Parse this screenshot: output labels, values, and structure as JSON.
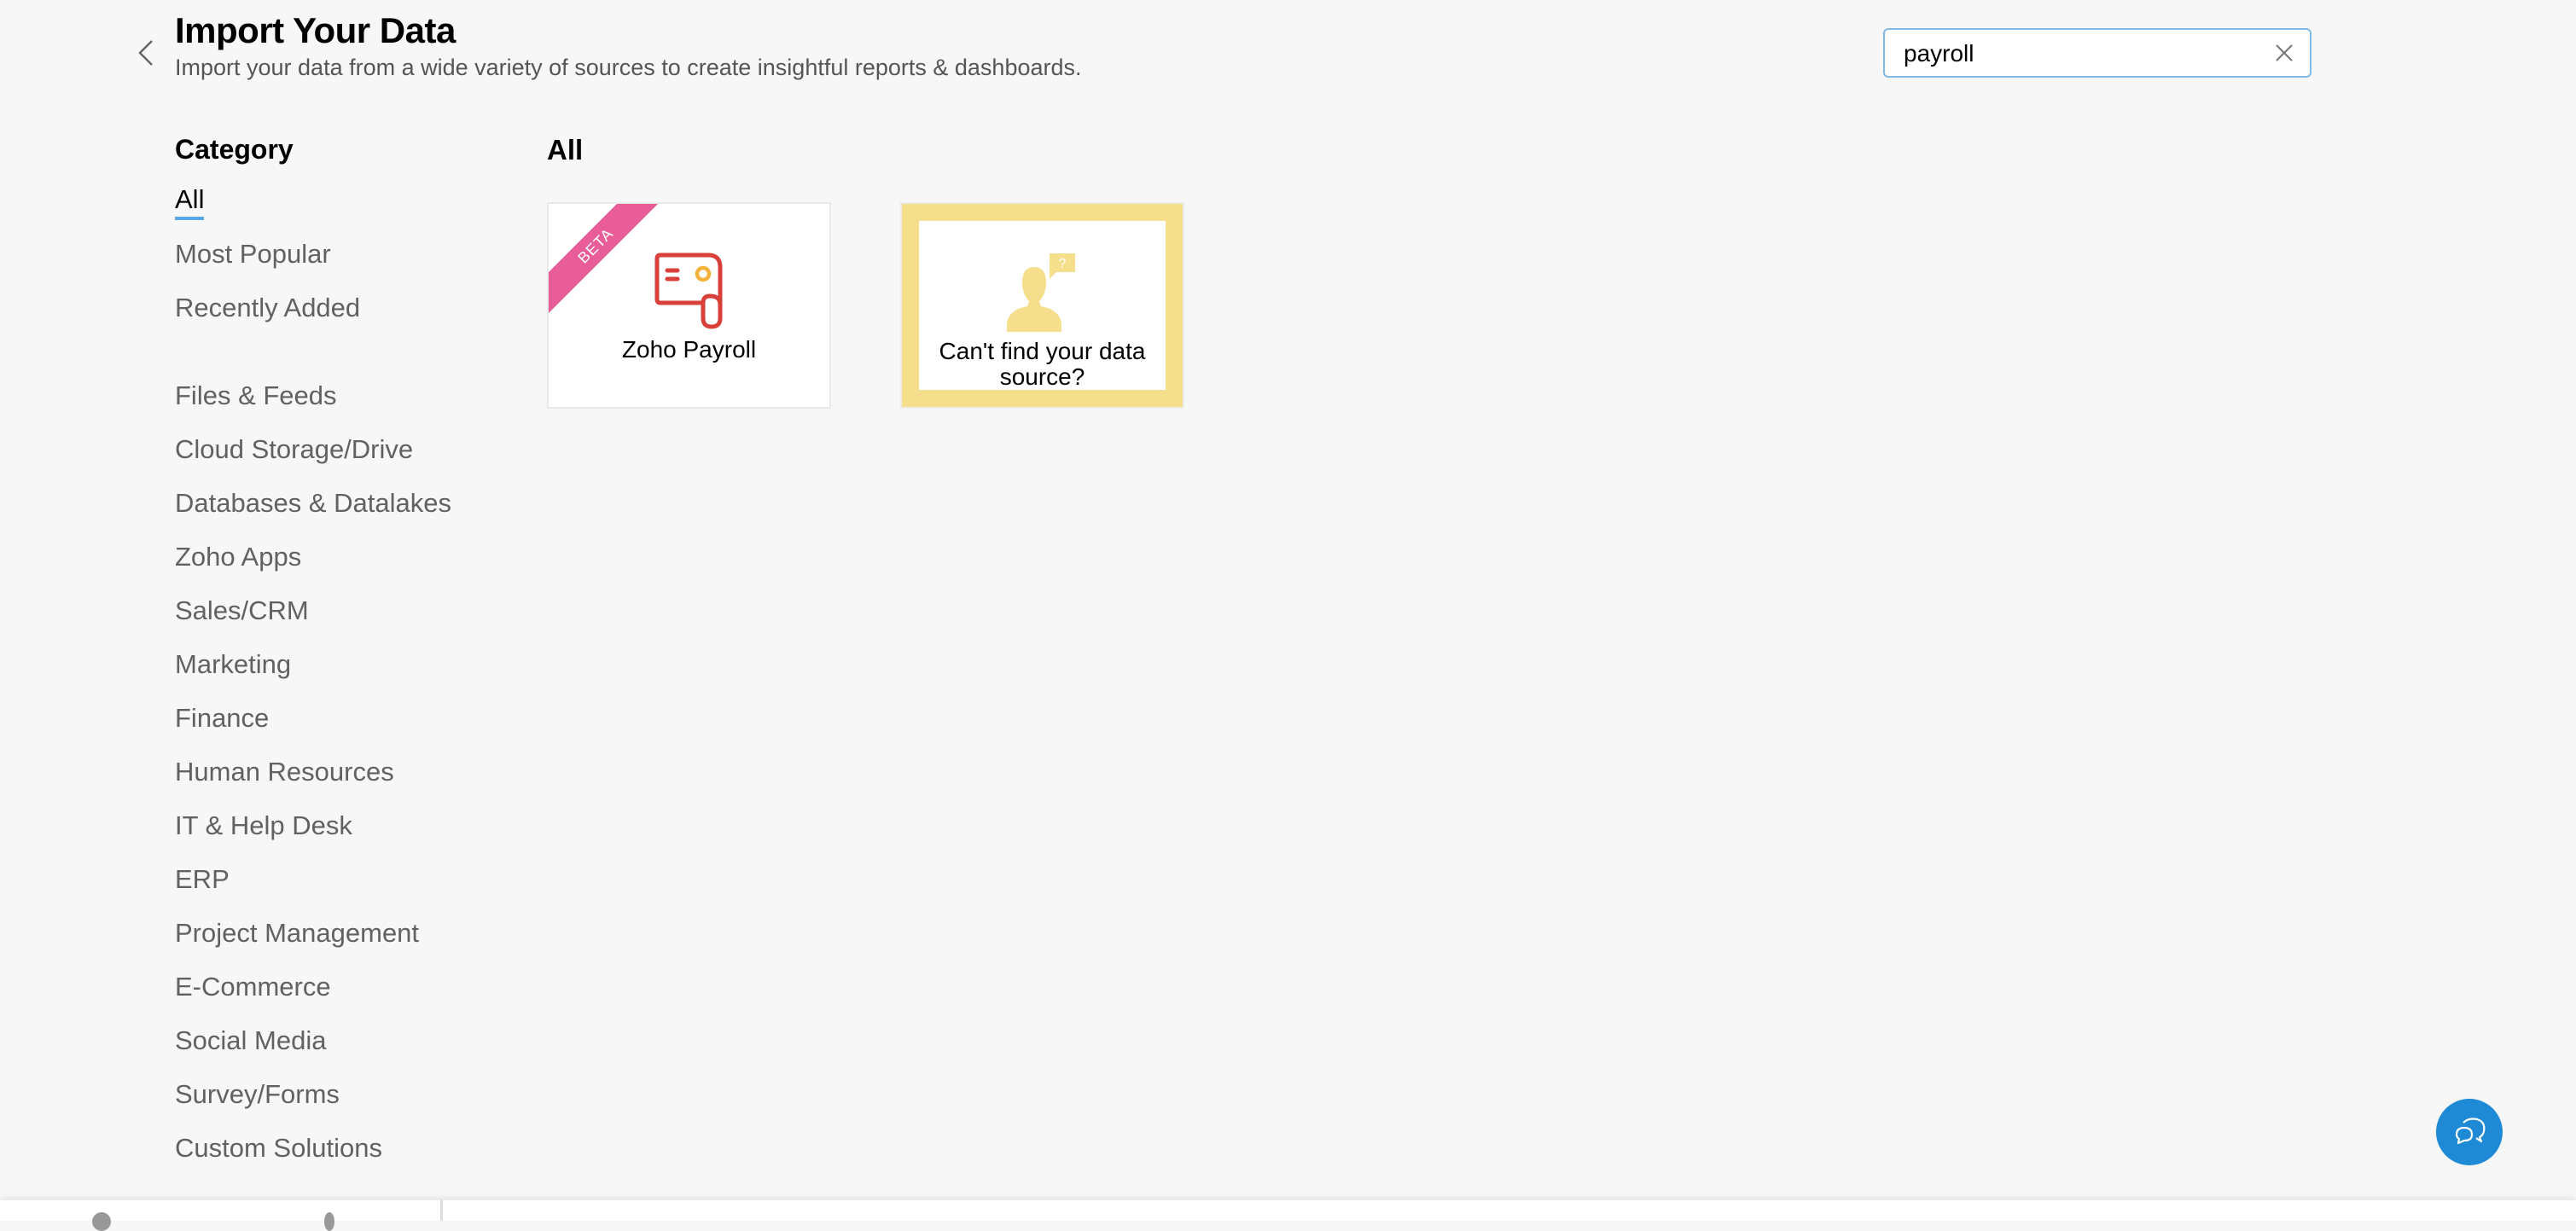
{
  "header": {
    "title": "Import Your Data",
    "subtitle": "Import your data from a wide variety of sources to create insightful reports & dashboards.",
    "back_icon": "chevron-left-icon"
  },
  "search": {
    "value": "payroll",
    "clear_icon": "close-icon"
  },
  "sidebar": {
    "heading": "Category",
    "items": [
      {
        "label": "All",
        "active": true
      },
      {
        "label": "Most Popular"
      },
      {
        "label": "Recently Added"
      },
      {
        "label": "Files & Feeds"
      },
      {
        "label": "Cloud Storage/Drive"
      },
      {
        "label": "Databases & Datalakes"
      },
      {
        "label": "Zoho Apps"
      },
      {
        "label": "Sales/CRM"
      },
      {
        "label": "Marketing"
      },
      {
        "label": "Finance"
      },
      {
        "label": "Human Resources"
      },
      {
        "label": "IT & Help Desk"
      },
      {
        "label": "ERP"
      },
      {
        "label": "Project Management"
      },
      {
        "label": "E-Commerce"
      },
      {
        "label": "Social Media"
      },
      {
        "label": "Survey/Forms"
      },
      {
        "label": "Custom Solutions"
      }
    ]
  },
  "main": {
    "section_title": "All",
    "cards": [
      {
        "label": "Zoho Payroll",
        "badge": "BETA",
        "icon": "payroll-icon"
      },
      {
        "label": "Can't find your data source?",
        "icon": "user-question-icon"
      }
    ]
  },
  "colors": {
    "accent": "#5aa9e6",
    "beta_badge": "#e85d97",
    "payroll_red": "#d9403a",
    "payroll_yellow": "#f2b33d",
    "missing_card": "#f5df8c",
    "chat_button": "#1e8ad6"
  },
  "chat": {
    "icon": "chat-bubbles-icon"
  }
}
